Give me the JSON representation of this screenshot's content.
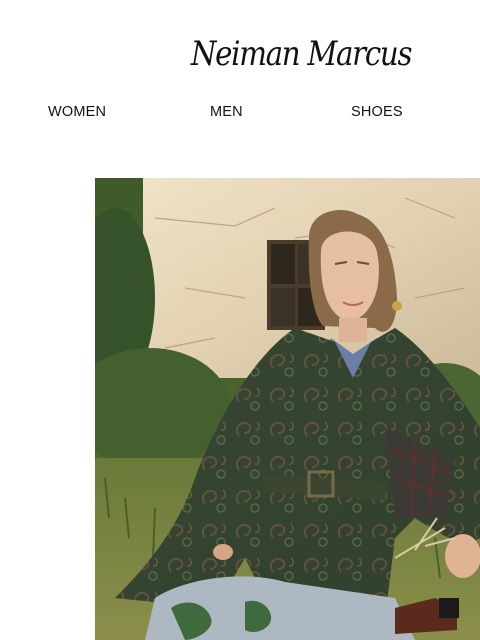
{
  "brand": {
    "logo_text": "Neiman Marcus"
  },
  "nav": {
    "items": [
      {
        "label": "WOMEN"
      },
      {
        "label": "MEN"
      },
      {
        "label": "SHOES"
      }
    ]
  },
  "hero": {
    "icon": "fashion-photo-image"
  }
}
